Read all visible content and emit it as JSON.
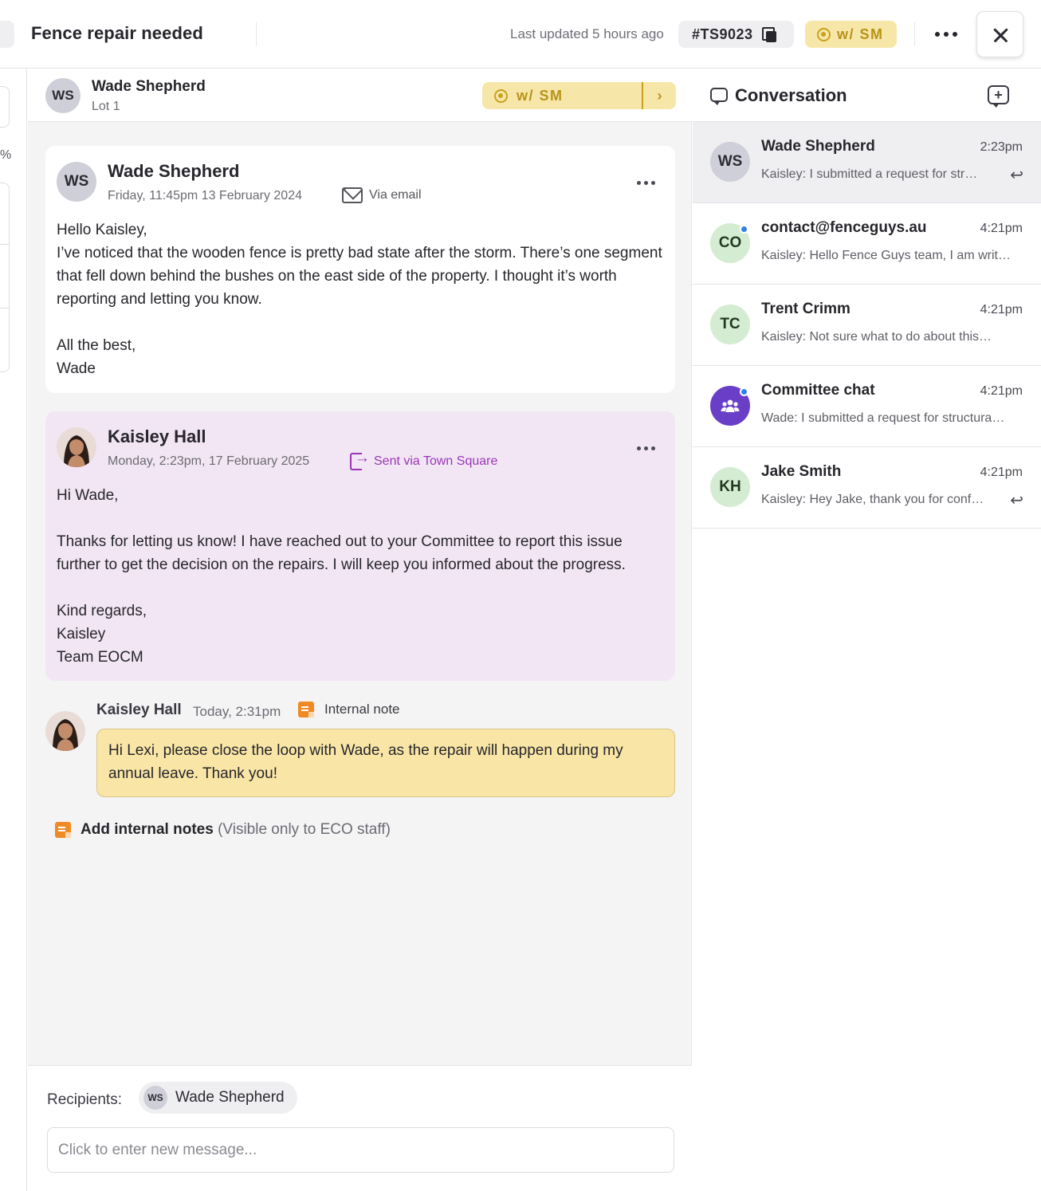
{
  "header": {
    "title": "Fence repair needed",
    "last_updated": "Last updated 5 hours ago",
    "ticket_id": "#TS9023",
    "status": "w/ SM"
  },
  "left_stub": {
    "partial_text": "%"
  },
  "contact": {
    "initials": "WS",
    "name": "Wade Shepherd",
    "lot": "Lot 1",
    "status": "w/ SM",
    "chevron": "›"
  },
  "messages": [
    {
      "initials": "WS",
      "author": "Wade Shepherd",
      "date": "Friday, 11:45pm 13 February 2024",
      "via": "Via email",
      "body": "Hello Kaisley,\nI’ve noticed that the wooden fence is pretty bad state after the storm. There’s one segment that fell down behind the bushes on the east side of the property. I thought it’s worth reporting and letting you know.\n\nAll the best,\nWade"
    },
    {
      "author": "Kaisley Hall",
      "date": "Monday, 2:23pm, 17 February 2025",
      "via": "Sent via Town Square",
      "body": "Hi Wade,\n\nThanks for letting us know! I have reached out to your Committee to report this issue further to get the decision on the repairs. I will keep you informed about the progress.\n\nKind regards,\nKaisley\nTeam EOCM"
    }
  ],
  "internal_note": {
    "author": "Kaisley Hall",
    "time": "Today, 2:31pm",
    "tag": "Internal note",
    "text": "Hi Lexi, please close the loop with Wade, as the repair will happen during my annual leave. Thank you!"
  },
  "add_notes": {
    "label": "Add internal notes",
    "hint": "(Visible only to ECO staff)"
  },
  "composer": {
    "recipients_label": "Recipients:",
    "recipient_initials": "WS",
    "recipient_name": "Wade Shepherd",
    "placeholder": "Click to enter new message..."
  },
  "conversation_panel": {
    "title": "Conversation",
    "items": [
      {
        "initials": "WS",
        "name": "Wade Shepherd",
        "time": "2:23pm",
        "preview": "Kaisley: I submitted a request for str…",
        "replied": true,
        "unread": false,
        "active": true
      },
      {
        "initials": "CO",
        "name": "contact@fenceguys.au",
        "time": "4:21pm",
        "preview": "Kaisley: Hello Fence Guys team, I am writ…",
        "replied": false,
        "unread": true,
        "active": false
      },
      {
        "initials": "TC",
        "name": "Trent Crimm",
        "time": "4:21pm",
        "preview": "Kaisley: Not sure what to do about this…",
        "replied": false,
        "unread": false,
        "active": false
      },
      {
        "initials": "",
        "name": "Committee chat",
        "time": "4:21pm",
        "preview": "Wade: I submitted a request for structura…",
        "replied": false,
        "unread": true,
        "active": false
      },
      {
        "initials": "KH",
        "name": "Jake Smith",
        "time": "4:21pm",
        "preview": "Kaisley: Hey Jake, thank you for conf…",
        "replied": true,
        "unread": false,
        "active": false
      }
    ]
  },
  "colors": {
    "status_bg": "#f6e7a8",
    "status_fg": "#b8921a",
    "reply_card_bg": "#f2e6f4",
    "sent_via": "#9b36b7",
    "note_bg": "#f9e6a6",
    "note_icon": "#f08a24",
    "unread": "#2f80ed",
    "group_avatar": "#6a3fc8"
  },
  "icons": {
    "copy": "copy-icon",
    "close": "close-icon",
    "more": "more-horizontal-icon",
    "mail": "mail-icon",
    "sent": "send-out-icon",
    "note": "note-icon",
    "chat": "chat-bubble-icon",
    "new_chat": "new-chat-icon",
    "reply": "reply-icon",
    "group": "group-icon"
  }
}
